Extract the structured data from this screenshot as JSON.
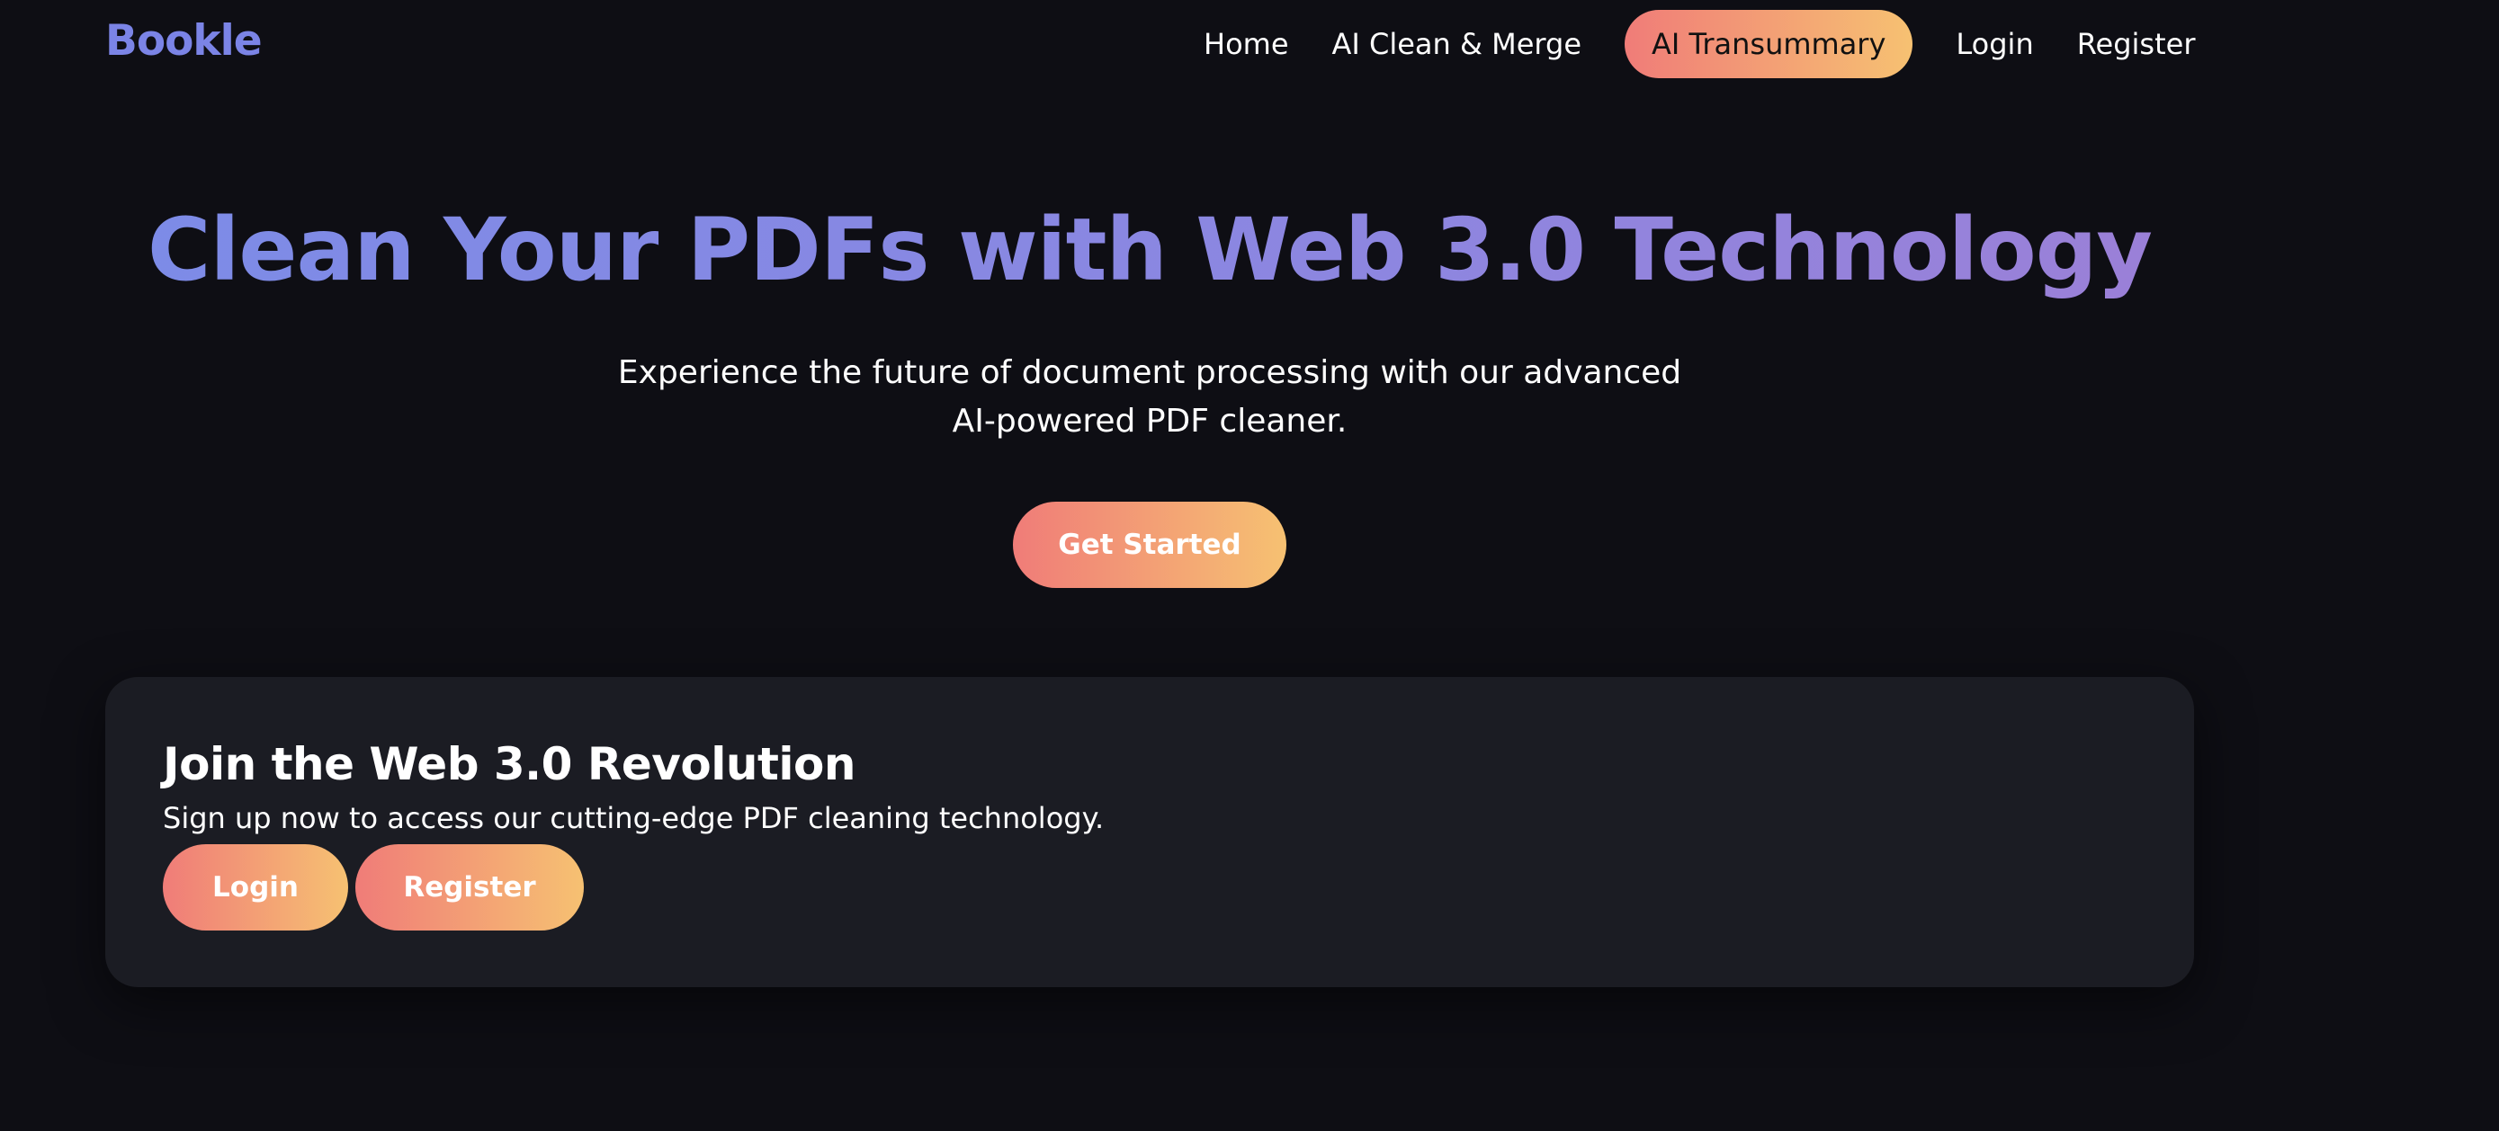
{
  "header": {
    "logo": "Bookle",
    "nav": {
      "home": "Home",
      "clean_merge": "AI Clean & Merge",
      "transummary": "AI Transummary",
      "login": "Login",
      "register": "Register"
    }
  },
  "hero": {
    "title": "Clean Your PDFs with Web 3.0 Technology",
    "subtitle_line1": "Experience the future of document processing with our advanced",
    "subtitle_line2": "AI-powered PDF cleaner.",
    "cta": "Get Started"
  },
  "signup_card": {
    "title": "Join the Web 3.0 Revolution",
    "text": "Sign up now to access our cutting-edge PDF cleaning technology.",
    "login_label": "Login",
    "register_label": "Register"
  },
  "colors": {
    "background": "#0e0e14",
    "card": "#1b1c23",
    "logo": "#7b84e6",
    "gradient_start": "#f07c78",
    "gradient_end": "#f6c172",
    "title_gradient_start": "#7b8ce8",
    "title_gradient_end": "#9d7fd6"
  }
}
